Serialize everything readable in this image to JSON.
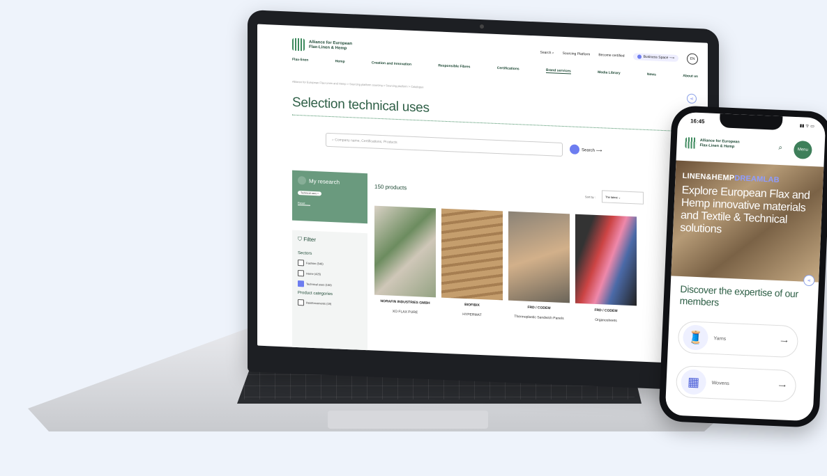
{
  "laptop_site": {
    "logo": {
      "line1": "Alliance for European",
      "line2": "Flax-Linen & Hemp"
    },
    "topbar": {
      "search": "Search",
      "sourcing": "Sourcing Platform",
      "certified": "Become certified",
      "business": "Business Space ⟶",
      "lang": "EN"
    },
    "nav": [
      "Flax-linen",
      "Hemp",
      "Creation and innovation",
      "Responsible Fibres",
      "Certifications",
      "Brand services",
      "Media Library",
      "News",
      "About us"
    ],
    "breadcrumb": "Alliance for European Flax-Linen and Hemp > Sourcing platform sourcing > Sourcing platform > Catalogue",
    "page_title": "Selection technical uses",
    "search": {
      "placeholder": "Company name, Certifications, Products",
      "button": "Search ⟶"
    },
    "my_research": {
      "title": "My research",
      "tag": "Technical uses ×",
      "reset": "Reset"
    },
    "filter": {
      "title": "Filter",
      "sectors_label": "Sectors",
      "sectors": [
        {
          "label": "Fashion (546)",
          "checked": false
        },
        {
          "label": "Home (425)",
          "checked": false
        },
        {
          "label": "Technical uses (150)",
          "checked": true
        }
      ],
      "categories_label": "Product categories",
      "categories": [
        {
          "label": "Reinforcements (19)",
          "checked": false
        }
      ]
    },
    "results_count": "150 products",
    "sort": {
      "label": "Sort by :",
      "value": "The latest"
    },
    "products": [
      {
        "brand": "NORAFIN INDUSTRIES GMBH",
        "name": "XO FLAX PURE"
      },
      {
        "brand": "BIOFIBIX",
        "name": "HYPERMAT"
      },
      {
        "brand": "FRD / CODEM",
        "name": "Thermoplastic Sandwich Panels"
      },
      {
        "brand": "FRD / CODEM",
        "name": "Organosheets"
      }
    ]
  },
  "phone_site": {
    "time": "16:45",
    "status": "▮▮ ᯤ ▭",
    "logo": {
      "line1": "Alliance for European",
      "line2": "Flax-Linen & Hemp"
    },
    "menu": "Menu",
    "hero_brand": {
      "part1": "LINEN&HEMP",
      "part2": "DREAMLAB"
    },
    "hero_text": "Explore European Flax and Hemp innovative materials and Textile & Technical solutions",
    "discover": "Discover the expertise of our members",
    "cards": [
      {
        "label": "Yarns",
        "arrow": "⟶"
      },
      {
        "label": "Wovens",
        "arrow": "⟶"
      }
    ]
  },
  "colors": {
    "brand_green": "#2e5f46",
    "accent": "#6d7df0",
    "panel_green": "#6a9a7e"
  }
}
